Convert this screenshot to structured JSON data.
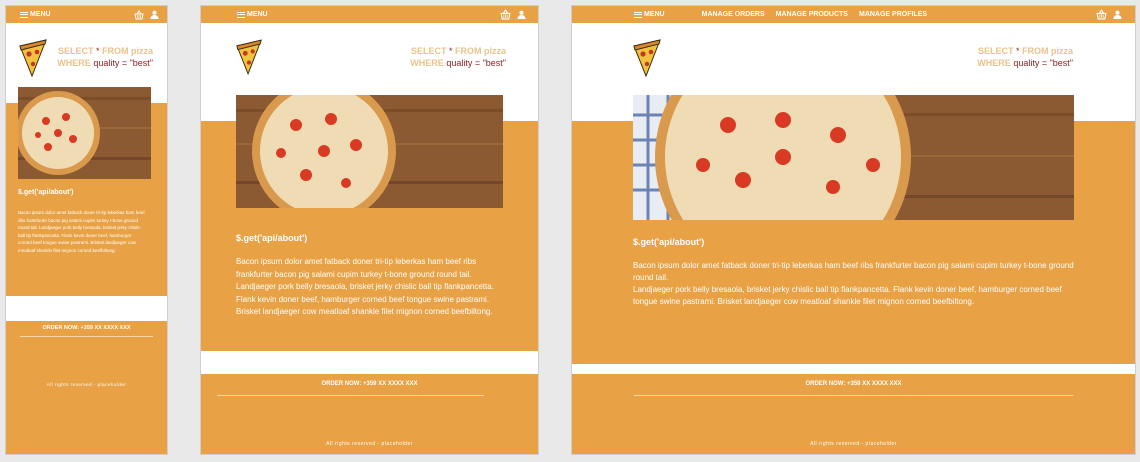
{
  "nav": {
    "menu_label": "MENU",
    "links": [
      "MANAGE ORDERS",
      "MANAGE PRODUCTS",
      "MANAGE PROFILES"
    ]
  },
  "hero": {
    "sql_line1_kw": "SELECT",
    "sql_line1_star": "*",
    "sql_line1_from": "FROM pizza",
    "sql_line2_kw": "WHERE",
    "sql_line2_val": "quality = \"best\""
  },
  "about": {
    "title": "$.get('api/about')",
    "text": "Bacon ipsum dolor amet fatback doner tri-tip leberkas ham beef ribs frankfurter bacon pig salami cupim turkey t-bone ground round tail. Landjaeger pork belly bresaola, brisket jerky chislic ball tip flankpancetta. Flank kevin doner beef, hamburger corned beef tongue swine pastrami. Brisket landjaeger cow meatloaf shankle filet mignon corned beefbiltong.",
    "text_small": "Bacon ipsum dolor amet fatback doner tri-tip leberkas ham beef ribs frankfurter bacon pig salami cupim turkey t-bone ground round tail. Landjaeger pork belly bresaola, brisket jerky chislic ball tip flankpancetta. Flank kevin doner beef, hamburger corned beef tongue swine pastrami. Brisket landjaeger cow meatloaf shankle filet mignon corned beefbiltong.",
    "text_wide_p1": "Bacon ipsum dolor amet fatback doner tri-tip leberkas ham beef ribs frankfurter bacon pig salami cupim turkey t-bone ground round tail.",
    "text_wide_p2": "Landjaeger pork belly bresaola, brisket jerky chislic ball tip flankpancetta. Flank kevin doner beef, hamburger corned beef tongue swine pastrami. Brisket landjaeger cow meatloaf shankle filet mignon corned beefbiltong."
  },
  "footer": {
    "order": "ORDER NOW: +359 XX XXXX XXX",
    "rights": "All rights reserved - placeholder"
  },
  "colors": {
    "brand": "#e8a144",
    "sql_keyword": "#e9c38c",
    "sql_value": "#8b1d1d"
  },
  "icons": [
    "hamburger-icon",
    "basket-icon",
    "user-icon",
    "pizza-logo-icon"
  ]
}
